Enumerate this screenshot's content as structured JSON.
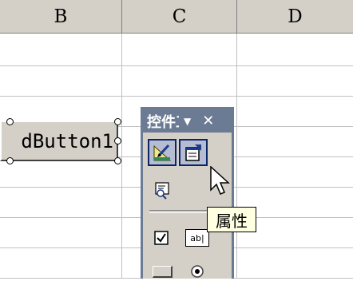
{
  "columns": [
    "B",
    "C",
    "D"
  ],
  "command_button": {
    "label": "dButton1"
  },
  "toolbox": {
    "title": "控件工具箱",
    "buttons": [
      {
        "icon": "design-mode-icon",
        "pressed": true
      },
      {
        "icon": "properties-icon",
        "pressed": true
      },
      {
        "icon": "view-code-icon",
        "pressed": false
      },
      {
        "icon": "checkbox-icon",
        "pressed": false
      },
      {
        "icon": "textbox-icon",
        "pressed": false,
        "label": "ab|"
      },
      {
        "icon": "command-button-icon",
        "pressed": false
      },
      {
        "icon": "option-button-icon",
        "pressed": false
      }
    ]
  },
  "tooltip": {
    "text": "属性"
  },
  "colors": {
    "grid": "#c0c0c0",
    "header": "#d4d0c8",
    "toolbox_title": "#6b7b93",
    "tooltip_bg": "#ffffe1"
  }
}
